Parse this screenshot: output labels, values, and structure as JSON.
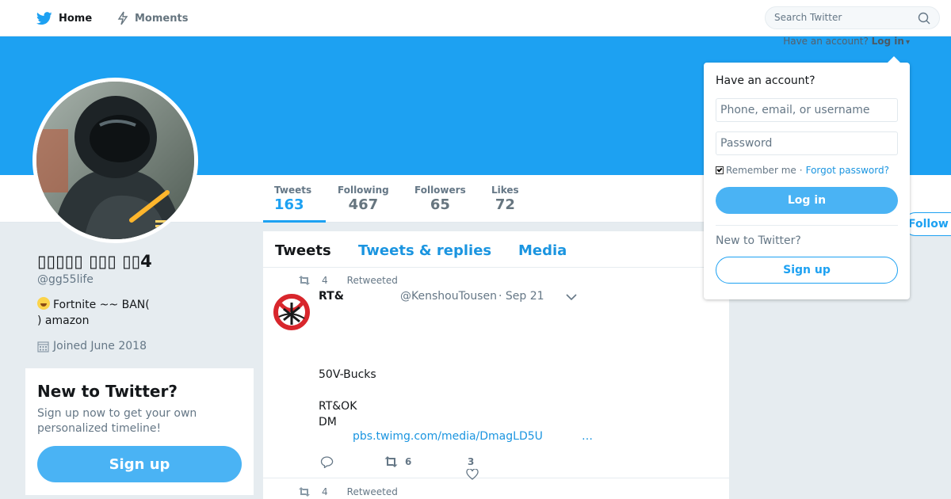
{
  "nav": {
    "home_label": "Home",
    "moments_label": "Moments",
    "search_placeholder": "Search Twitter"
  },
  "account_prompt": {
    "text": "Have an account?",
    "login_link": "Log in",
    "caret": "▾"
  },
  "stats": [
    {
      "label": "Tweets",
      "value": "163"
    },
    {
      "label": "Following",
      "value": "467"
    },
    {
      "label": "Followers",
      "value": "65"
    },
    {
      "label": "Likes",
      "value": "72"
    }
  ],
  "follow_label": "Follow",
  "profile": {
    "name": "▯▯▯▯▯ ▯▯▯ ▯▯4",
    "handle": "@gg55life",
    "bio_line1": "Fortnite ~~  BAN(",
    "bio_line2": ")  amazon",
    "joined": "Joined June 2018"
  },
  "new_card": {
    "title": "New to Twitter?",
    "text": "Sign up now to get your own personalized timeline!",
    "button": "Sign up"
  },
  "tabs": [
    "Tweets",
    "Tweets & replies",
    "Media"
  ],
  "tweets": [
    {
      "retweet_count_top": "4",
      "retweeted_label": "Retweeted",
      "name": "RT&",
      "handle": "@KenshouTousen",
      "date": "· Sep 21",
      "text_lines": [
        "50V-Bucks",
        "",
        "RT&OK",
        "DM"
      ],
      "link": "pbs.twimg.com/media/DmagLD5U",
      "more": "…",
      "retweets": "6",
      "likes": "3"
    },
    {
      "retweet_count_top": "4",
      "retweeted_label": "Retweeted"
    }
  ],
  "login": {
    "title": "Have an account?",
    "username_placeholder": "Phone, email, or username",
    "password_placeholder": "Password",
    "remember": "Remember me",
    "separator": "·",
    "forgot": "Forgot password?",
    "login_button": "Log in",
    "new_label": "New to Twitter?",
    "signup_button": "Sign up"
  },
  "colors": {
    "brand": "#1da1f2",
    "link": "#1b95e0",
    "button": "#4ab3f4",
    "background": "#e6ecf0"
  },
  "icons": [
    "twitter-bird-icon",
    "lightning-icon",
    "search-icon",
    "calendar-icon",
    "retweet-icon",
    "reply-icon",
    "heart-icon",
    "chevron-down-icon",
    "checkbox-icon"
  ]
}
